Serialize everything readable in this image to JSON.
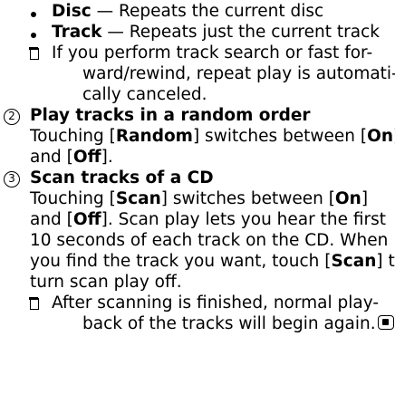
{
  "repeat_options": [
    {
      "term": "Disc",
      "desc": " — Repeats the current disc"
    },
    {
      "term": "Track",
      "desc": " — Repeats just the current track"
    }
  ],
  "repeat_note": {
    "line1": "If you perform track search or fast for-",
    "line2": "ward/rewind, repeat play is automati-",
    "line3": "cally canceled."
  },
  "section_random": {
    "number": "2",
    "title": "Play tracks in a random order",
    "line1_pre": "Touching [",
    "line1_bold": "Random",
    "line1_mid": "] switches between [",
    "line1_bold2": "On",
    "line1_post": "]",
    "line2_pre": "and [",
    "line2_bold": "Off",
    "line2_post": "]."
  },
  "section_scan": {
    "number": "3",
    "title": "Scan tracks of a CD",
    "line1_pre": "Touching [",
    "line1_bold": "Scan",
    "line1_mid": "] switches between [",
    "line1_bold2": "On",
    "line1_post": "]",
    "line2_pre": "and [",
    "line2_bold": "Off",
    "line2_post": "]. Scan play lets you hear the first",
    "line3": "10 seconds of each track on the CD. When",
    "line4_pre": "you find the track you want, touch [",
    "line4_bold": "Scan",
    "line4_post": "] to",
    "line5": "turn scan play off."
  },
  "scan_note": {
    "line1": "After scanning is finished, normal play-",
    "line2": "back of the tracks will begin again."
  },
  "icons": {
    "bullet": "bullet-dot-icon",
    "note": "note-square-icon",
    "end": "end-mark-icon"
  }
}
